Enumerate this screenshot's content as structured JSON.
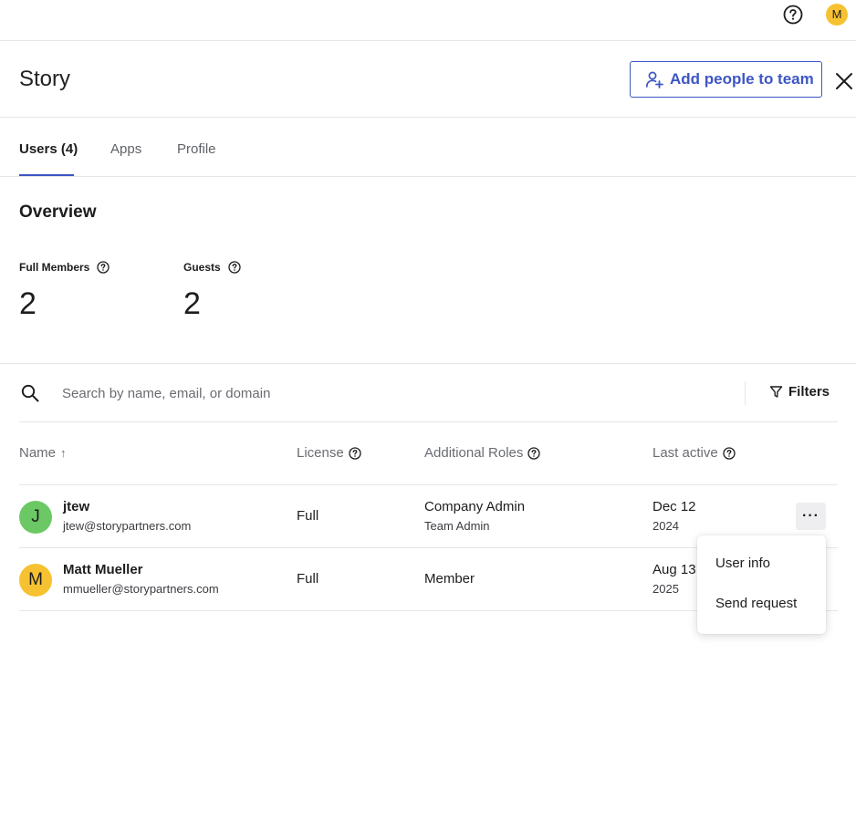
{
  "topbar": {
    "help_icon": "help-circle-icon",
    "user_initial": "M",
    "user_avatar_color": "#f6c231"
  },
  "header": {
    "title": "Story",
    "add_button_label": "Add people to team",
    "add_button_icon": "person-add-icon",
    "close_icon": "close-icon",
    "accent_color": "#3d56c3"
  },
  "tabs": [
    {
      "label": "Users (4)",
      "active": true
    },
    {
      "label": "Apps",
      "active": false
    },
    {
      "label": "Profile",
      "active": false
    }
  ],
  "overview": {
    "title": "Overview",
    "stats": [
      {
        "label": "Full Members",
        "value": "2"
      },
      {
        "label": "Guests",
        "value": "2"
      }
    ]
  },
  "search": {
    "placeholder": "Search by name, email, or domain",
    "value": "",
    "filters_label": "Filters"
  },
  "table": {
    "columns": [
      {
        "label": "Name",
        "sort": "↑"
      },
      {
        "label": "License"
      },
      {
        "label": "Additional Roles"
      },
      {
        "label": "Last active"
      }
    ],
    "rows": [
      {
        "initial": "J",
        "avatar_color": "#6cc865",
        "name": "jtew",
        "email": "jtew@storypartners.com",
        "license": "Full",
        "role": "Company Admin",
        "role_sub": "Team Admin",
        "last_active": "Dec 12",
        "last_active_year": "2024",
        "more_label": "···"
      },
      {
        "initial": "M",
        "avatar_color": "#f6c231",
        "name": "Matt Mueller",
        "email": "mmueller@storypartners.com",
        "license": "Full",
        "role": "Member",
        "role_sub": "",
        "last_active": "Aug 13",
        "last_active_year": "2025"
      }
    ]
  },
  "context_menu": {
    "items": [
      "User info",
      "Send request"
    ]
  }
}
